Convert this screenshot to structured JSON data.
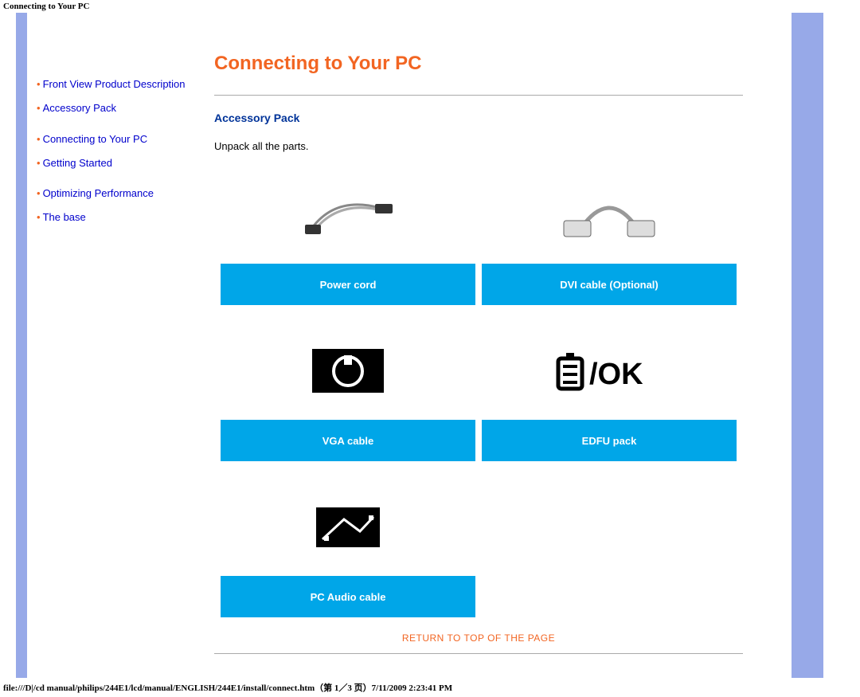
{
  "header_title": "Connecting to Your PC",
  "page_title": "Connecting to Your PC",
  "sidebar": {
    "items": [
      {
        "label": "Front View Product Description"
      },
      {
        "label": "Accessory Pack"
      },
      {
        "label": "Connecting to Your PC"
      },
      {
        "label": "Getting Started"
      },
      {
        "label": "Optimizing Performance"
      },
      {
        "label": "The base"
      }
    ]
  },
  "section": {
    "heading": "Accessory Pack",
    "intro": "Unpack all the parts."
  },
  "accessories": {
    "power_cord": "Power cord",
    "dvi_cable": "DVI cable (Optional)",
    "vga_cable": "VGA cable",
    "edfu_pack": "EDFU pack",
    "pc_audio": "PC Audio cable"
  },
  "return_link": "RETURN TO TOP OF THE PAGE",
  "footer_path": "file:///D|/cd manual/philips/244E1/lcd/manual/ENGLISH/244E1/install/connect.htm（第 1／3 页）7/11/2009 2:23:41 PM"
}
